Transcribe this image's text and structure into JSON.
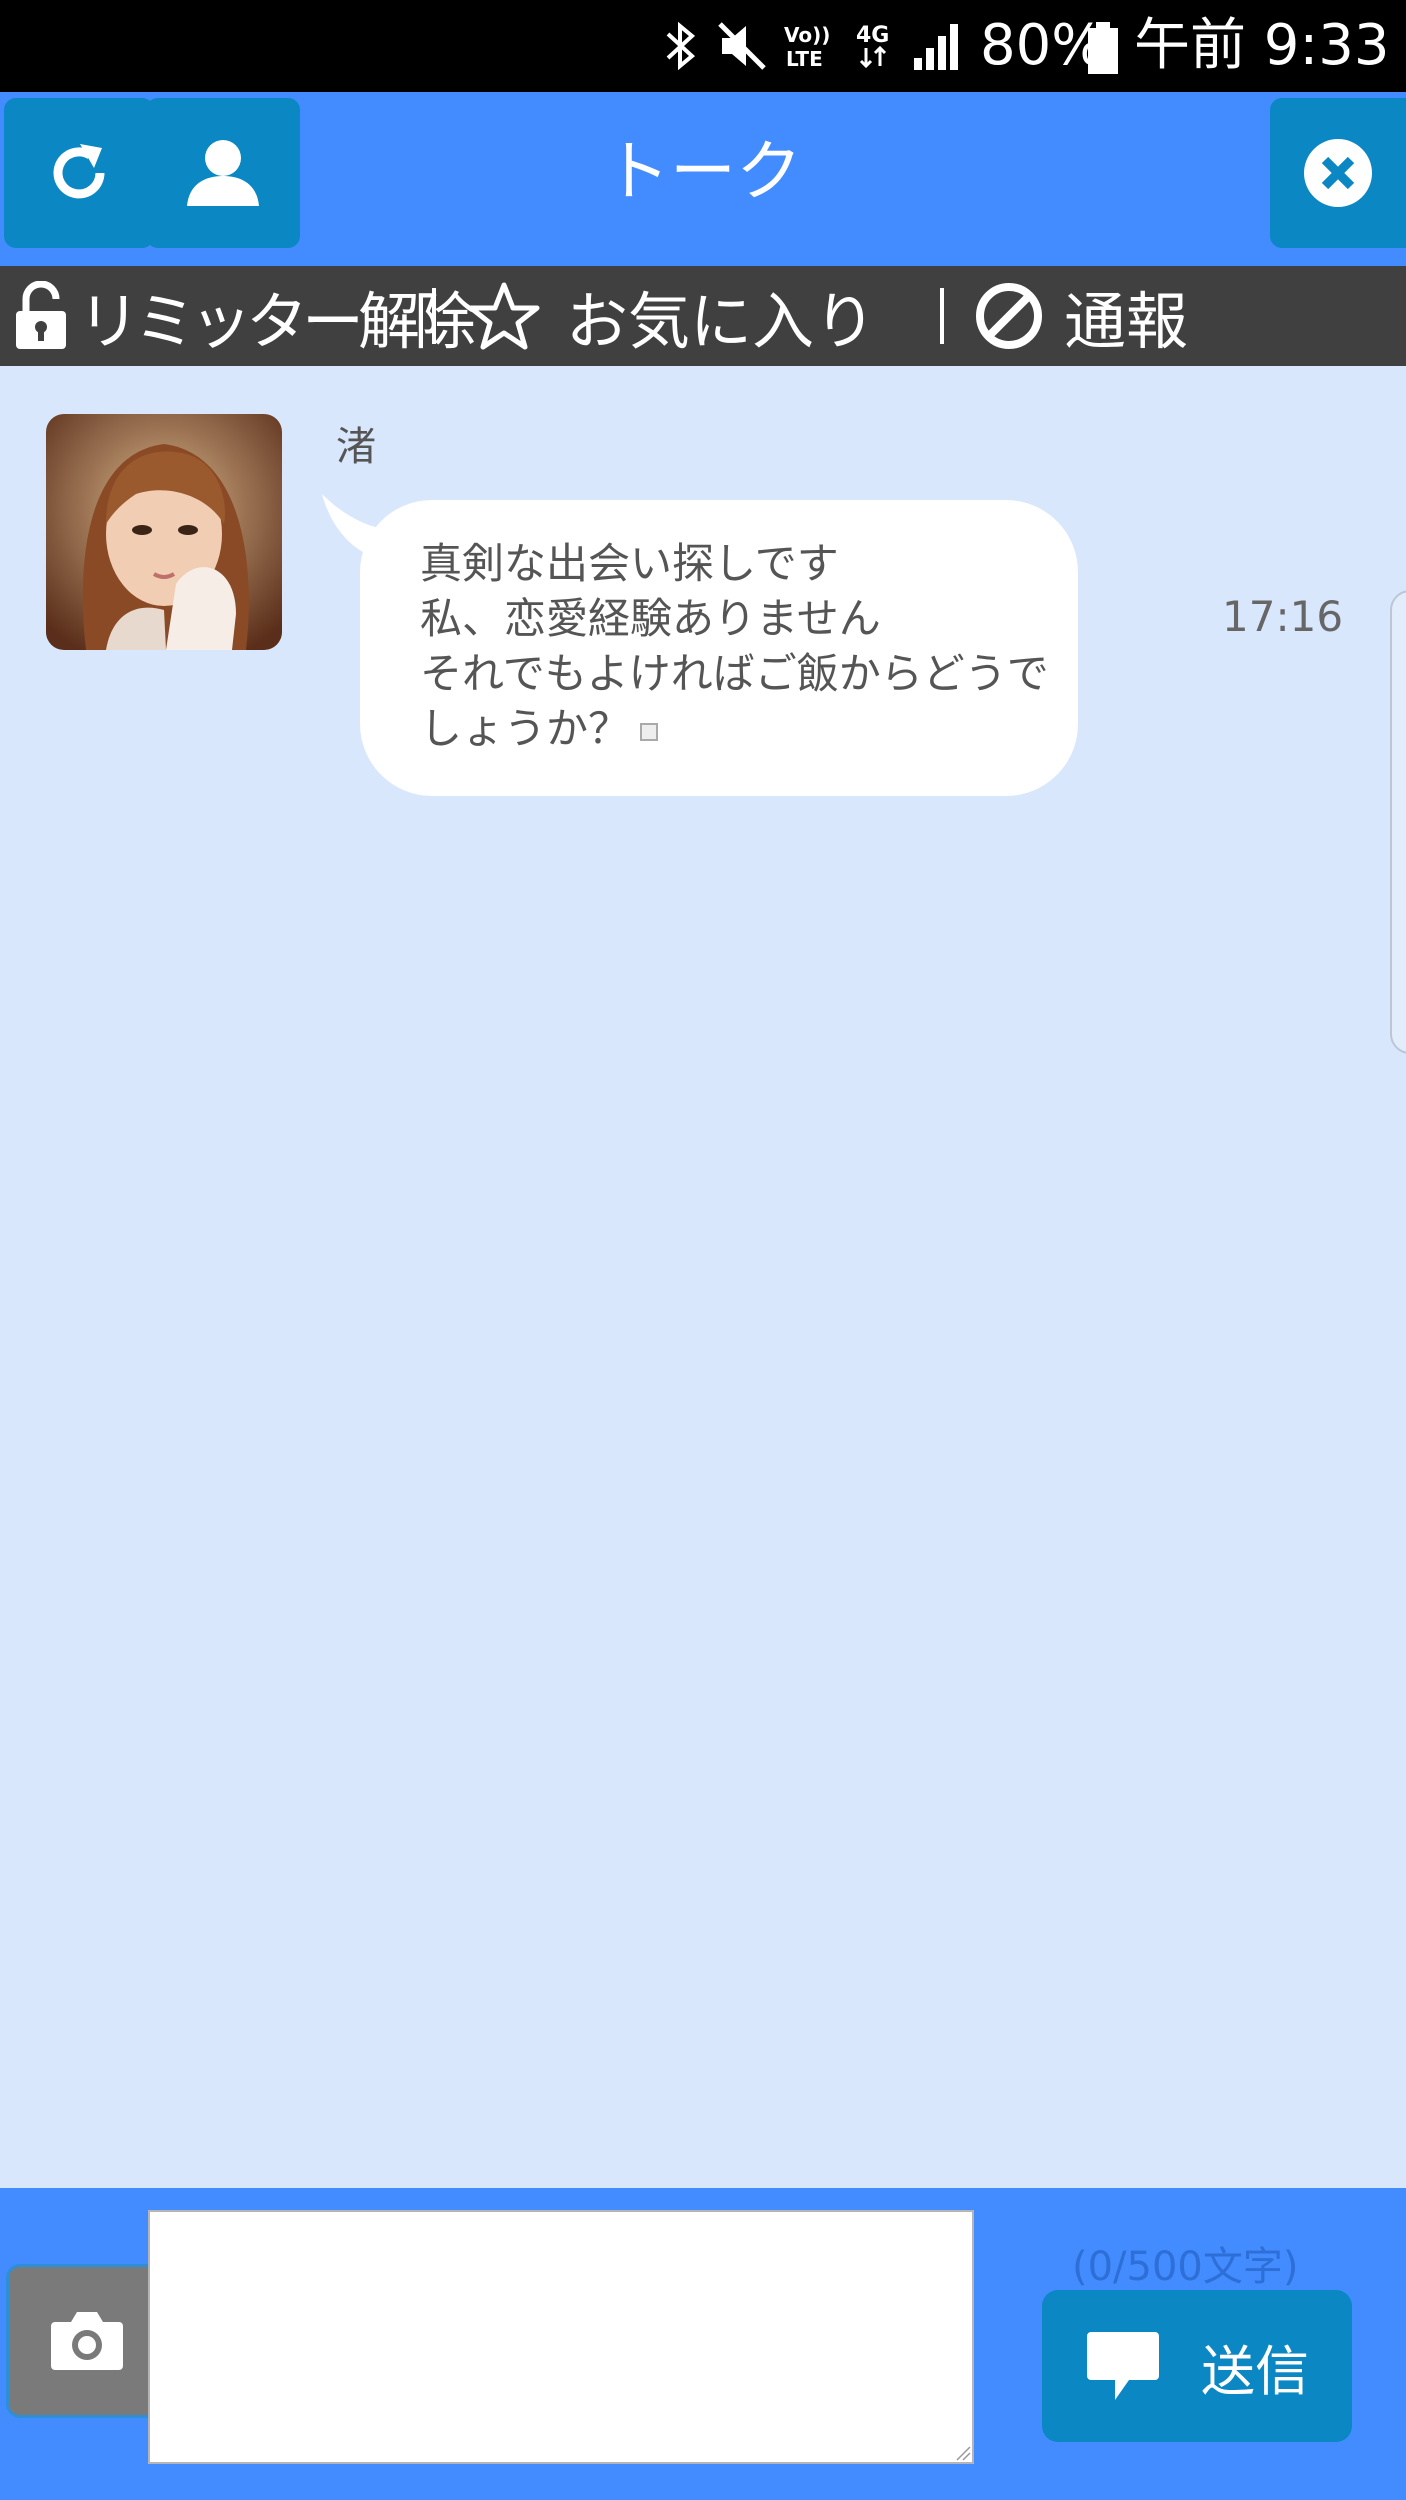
{
  "status_bar": {
    "battery": "80%",
    "time": "午前 9:33",
    "icons": [
      "bluetooth-icon",
      "mute-icon",
      "volte-icon",
      "4g-icon",
      "signal-icon",
      "battery-icon"
    ],
    "volte_label": "VoLTE",
    "network_label": "4G"
  },
  "header": {
    "title": "トーク",
    "refresh_icon": "refresh-icon",
    "profile_icon": "user-icon",
    "close_icon": "close-icon"
  },
  "actions": {
    "limiter": "リミッター解除",
    "favorite": "お気に入り",
    "report": "通報"
  },
  "messages": [
    {
      "sender": "渚",
      "text": "真剣な出会い探しです\n私、恋愛経験ありません\nそれでもよければご飯からどうでしょうか？",
      "time": "17:16"
    }
  ],
  "composer": {
    "value": "",
    "char_count": "(0/500文字)",
    "send_label": "送信",
    "camera_icon": "camera-icon",
    "send_icon": "speech-bubble-icon"
  },
  "colors": {
    "header_bg": "#428cff",
    "button_bg": "#0b87c3",
    "action_bar_bg": "#404040",
    "chat_bg": "#d9e7fd"
  }
}
